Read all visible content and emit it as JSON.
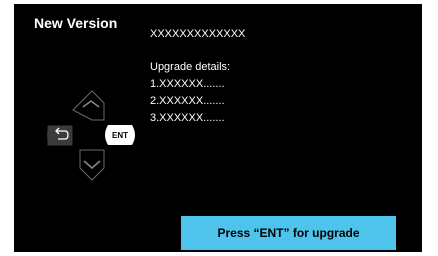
{
  "screen": {
    "title": "New Version",
    "model_name": "XXXXXXXXXXXXX",
    "details_heading": "Upgrade details:",
    "details_items": [
      "1.XXXXXX.......",
      "2.XXXXXX.......",
      "3.XXXXXX......."
    ]
  },
  "remote": {
    "ent_label": "ENT",
    "icons": [
      "up-arrow-icon",
      "back-icon",
      "ent-button",
      "down-arrow-icon"
    ]
  },
  "action": {
    "upgrade_label": "Press  “ENT”  for upgrade"
  },
  "colors": {
    "screen_bg": "#000000",
    "accent": "#4ec3ec",
    "key_grey": "#3b3b3b"
  }
}
